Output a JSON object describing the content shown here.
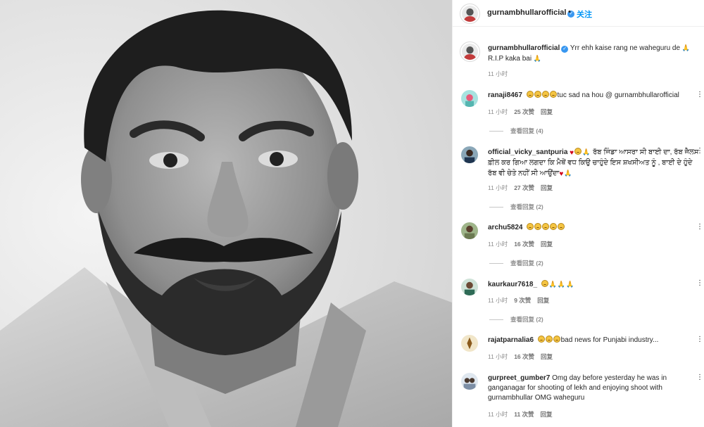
{
  "colors": {
    "accent": "#0095f6",
    "verified": "#3897f0",
    "muted": "#8e8e8e",
    "text": "#262626"
  },
  "post": {
    "author": "gurnambhullarofficial",
    "follow_label": "关注",
    "separator": "•",
    "caption_user": "gurnambhullarofficial",
    "caption_text": "Yrr ehh kaise rang ne waheguru de",
    "caption_line2": "R.I.P kaka bai",
    "caption_time": "11 小时"
  },
  "comments": [
    {
      "user": "ranaji8467",
      "prefix_emoji": [
        "sad",
        "sad",
        "sad",
        "sad"
      ],
      "text": "tuc sad na hou @ gurnambhullarofficial",
      "time": "11 小时",
      "likes": "25 次赞",
      "reply": "回复",
      "view_replies": "查看回复 (4)"
    },
    {
      "user": "official_vicky_santpuria",
      "prefix_emoji": [
        "heart",
        "sad",
        "pray"
      ],
      "text": "ਰੱਬ ਜਿੰਡਾ ਆਸਰਾ ਸੀ ਬਾਈ ਦਾ, ਰੱਬ ਜੈਲਸ ਫ਼ੀਲ ਕਰ ਗਿਆ ਲਗਦਾ ਕਿ ਮੈਥੋਂ ਵਧ ਕਿਉ ਚਾਹੁੰਦੇ ਇਸ ਸ਼ਖਸੀਅਤ ਨੂੰ , ਬਾਈ ਦੇ ਹੁੰਦੇ ਰੱਬ ਵੀ ਚੇਤੇ ਨਹੀਂ ਸੀ ਆਉਂਦਾ",
      "suffix_emoji": [
        "heart",
        "pray"
      ],
      "time": "11 小时",
      "likes": "27 次赞",
      "reply": "回复",
      "view_replies": "查看回复 (2)"
    },
    {
      "user": "archu5824",
      "prefix_emoji": [
        "sad",
        "sad",
        "sad",
        "sad",
        "sad"
      ],
      "text": "",
      "time": "11 小时",
      "likes": "16 次赞",
      "reply": "回复",
      "view_replies": "查看回复 (2)"
    },
    {
      "user": "kaurkaur7618_",
      "prefix_emoji": [
        "sad",
        "pray",
        "pray",
        "pray"
      ],
      "text": "",
      "time": "11 小时",
      "likes": "9 次赞",
      "reply": "回复",
      "view_replies": "查看回复 (2)"
    },
    {
      "user": "rajatparnalia6",
      "prefix_emoji": [
        "sad",
        "sad",
        "sad"
      ],
      "text": "bad news for Punjabi industry...",
      "time": "11 小时",
      "likes": "16 次赞",
      "reply": "回复"
    },
    {
      "user": "gurpreet_gumber7",
      "prefix_emoji": [],
      "text": "Omg day before yesterday he was in ganganagar for shooting of lekh and enjoying shoot with gurnambhullar OMG waheguru",
      "time": "11 小时",
      "likes": "11 次赞",
      "reply": "回复"
    }
  ]
}
